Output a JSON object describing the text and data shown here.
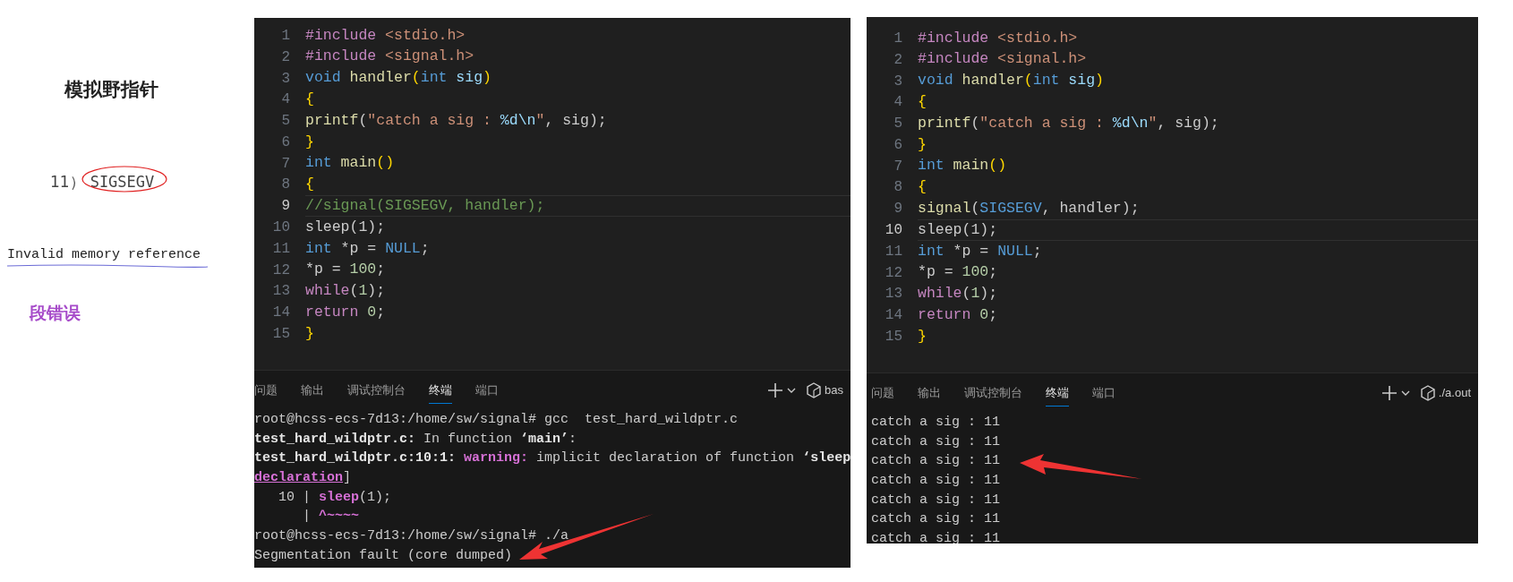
{
  "notes": {
    "title": "模拟野指针",
    "signal_number": "11）",
    "signal_name": "SIGSEGV",
    "description": "Invalid memory reference",
    "meaning": "段错误"
  },
  "editors": [
    {
      "lines": [
        {
          "number": "1",
          "current": false,
          "tokens": [
            {
              "kind": "directive",
              "text": "#include"
            },
            {
              "kind": "string",
              "text": " <stdio.h>"
            }
          ]
        },
        {
          "number": "2",
          "current": false,
          "tokens": [
            {
              "kind": "directive",
              "text": "#include"
            },
            {
              "kind": "string",
              "text": " <signal.h>"
            }
          ]
        },
        {
          "number": "3",
          "current": false,
          "tokens": [
            {
              "kind": "keyword",
              "text": "void"
            },
            {
              "kind": "func",
              "text": " handler"
            },
            {
              "kind": "bracket",
              "text": "("
            },
            {
              "kind": "keyword",
              "text": "int"
            },
            {
              "kind": "param",
              "text": " sig"
            },
            {
              "kind": "bracket",
              "text": ")"
            }
          ]
        },
        {
          "number": "4",
          "current": false,
          "tokens": [
            {
              "kind": "bracket",
              "text": "{"
            }
          ]
        },
        {
          "number": "5",
          "current": false,
          "tokens": [
            {
              "kind": "func",
              "text": "printf"
            },
            {
              "kind": "plain",
              "text": "("
            },
            {
              "kind": "string",
              "text": "\"catch a sig : "
            },
            {
              "kind": "format",
              "text": "%d\\n"
            },
            {
              "kind": "string",
              "text": "\""
            },
            {
              "kind": "plain",
              "text": ", sig);"
            }
          ]
        },
        {
          "number": "6",
          "current": false,
          "tokens": [
            {
              "kind": "bracket",
              "text": "}"
            }
          ]
        },
        {
          "number": "7",
          "current": false,
          "tokens": [
            {
              "kind": "keyword",
              "text": "int"
            },
            {
              "kind": "func",
              "text": " main"
            },
            {
              "kind": "bracket",
              "text": "()"
            }
          ]
        },
        {
          "number": "8",
          "current": false,
          "tokens": [
            {
              "kind": "bracket",
              "text": "{"
            }
          ]
        },
        {
          "number": "9",
          "current": true,
          "tokens": [
            {
              "kind": "comment",
              "text": "//signal(SIGSEGV, handler);"
            }
          ]
        },
        {
          "number": "10",
          "current": false,
          "tokens": [
            {
              "kind": "plain",
              "text": "sleep(1);"
            }
          ]
        },
        {
          "number": "11",
          "current": false,
          "tokens": [
            {
              "kind": "keyword",
              "text": "int"
            },
            {
              "kind": "plain",
              "text": " *p = "
            },
            {
              "kind": "keyword",
              "text": "NULL"
            },
            {
              "kind": "plain",
              "text": ";"
            }
          ]
        },
        {
          "number": "12",
          "current": false,
          "tokens": [
            {
              "kind": "plain",
              "text": "*p = "
            },
            {
              "kind": "number",
              "text": "100"
            },
            {
              "kind": "plain",
              "text": ";"
            }
          ]
        },
        {
          "number": "13",
          "current": false,
          "tokens": [
            {
              "kind": "directive",
              "text": "while"
            },
            {
              "kind": "plain",
              "text": "("
            },
            {
              "kind": "number",
              "text": "1"
            },
            {
              "kind": "plain",
              "text": ");"
            }
          ]
        },
        {
          "number": "14",
          "current": false,
          "tokens": [
            {
              "kind": "directive",
              "text": "return"
            },
            {
              "kind": "number",
              "text": " 0"
            },
            {
              "kind": "plain",
              "text": ";"
            }
          ]
        },
        {
          "number": "15",
          "current": false,
          "tokens": [
            {
              "kind": "bracket",
              "text": "}"
            }
          ]
        }
      ],
      "panel": {
        "tabs": [
          {
            "label": "问题",
            "selected": false
          },
          {
            "label": "输出",
            "selected": false
          },
          {
            "label": "调试控制台",
            "selected": false
          },
          {
            "label": "终端",
            "selected": true
          },
          {
            "label": "端口",
            "selected": false
          }
        ],
        "shell_label": "bas",
        "lines": [
          [
            {
              "kind": "plain",
              "text": "root@hcss-ecs-7d13:/home/sw/signal# gcc  test_hard_wildptr.c"
            }
          ],
          [
            {
              "kind": "bold",
              "text": "test_hard_wildptr.c:"
            },
            {
              "kind": "plain",
              "text": " In function "
            },
            {
              "kind": "bold",
              "text": "‘main’"
            },
            {
              "kind": "plain",
              "text": ":"
            }
          ],
          [
            {
              "kind": "bold",
              "text": "test_hard_wildptr.c:10:1:"
            },
            {
              "kind": "warning",
              "text": " warning:"
            },
            {
              "kind": "plain",
              "text": " implicit declaration of function "
            },
            {
              "kind": "bold",
              "text": "‘sleep"
            }
          ],
          [
            {
              "kind": "link",
              "text": "declaration"
            },
            {
              "kind": "plain",
              "text": "]"
            }
          ],
          [
            {
              "kind": "plain",
              "text": "   10 | "
            },
            {
              "kind": "warning",
              "text": "sleep"
            },
            {
              "kind": "plain",
              "text": "(1);"
            }
          ],
          [
            {
              "kind": "plain",
              "text": "      | "
            },
            {
              "kind": "warning",
              "text": "^~~~~"
            }
          ],
          [
            {
              "kind": "plain",
              "text": "root@hcss-ecs-7d13:/home/sw/signal# ./a"
            }
          ],
          [
            {
              "kind": "plain",
              "text": "Segmentation fault (core dumped)"
            }
          ]
        ]
      }
    },
    {
      "lines": [
        {
          "number": "1",
          "current": false,
          "tokens": [
            {
              "kind": "directive",
              "text": "#include"
            },
            {
              "kind": "string",
              "text": " <stdio.h>"
            }
          ]
        },
        {
          "number": "2",
          "current": false,
          "tokens": [
            {
              "kind": "directive",
              "text": "#include"
            },
            {
              "kind": "string",
              "text": " <signal.h>"
            }
          ]
        },
        {
          "number": "3",
          "current": false,
          "tokens": [
            {
              "kind": "keyword",
              "text": "void"
            },
            {
              "kind": "func",
              "text": " handler"
            },
            {
              "kind": "bracket",
              "text": "("
            },
            {
              "kind": "keyword",
              "text": "int"
            },
            {
              "kind": "param",
              "text": " sig"
            },
            {
              "kind": "bracket",
              "text": ")"
            }
          ]
        },
        {
          "number": "4",
          "current": false,
          "tokens": [
            {
              "kind": "bracket",
              "text": "{"
            }
          ]
        },
        {
          "number": "5",
          "current": false,
          "tokens": [
            {
              "kind": "func",
              "text": "printf"
            },
            {
              "kind": "plain",
              "text": "("
            },
            {
              "kind": "string",
              "text": "\"catch a sig : "
            },
            {
              "kind": "format",
              "text": "%d\\n"
            },
            {
              "kind": "string",
              "text": "\""
            },
            {
              "kind": "plain",
              "text": ", sig);"
            }
          ]
        },
        {
          "number": "6",
          "current": false,
          "tokens": [
            {
              "kind": "bracket",
              "text": "}"
            }
          ]
        },
        {
          "number": "7",
          "current": false,
          "tokens": [
            {
              "kind": "keyword",
              "text": "int"
            },
            {
              "kind": "func",
              "text": " main"
            },
            {
              "kind": "bracket",
              "text": "()"
            }
          ]
        },
        {
          "number": "8",
          "current": false,
          "tokens": [
            {
              "kind": "bracket",
              "text": "{"
            }
          ]
        },
        {
          "number": "9",
          "current": false,
          "tokens": [
            {
              "kind": "func",
              "text": "signal"
            },
            {
              "kind": "plain",
              "text": "("
            },
            {
              "kind": "keyword",
              "text": "SIGSEGV"
            },
            {
              "kind": "plain",
              "text": ", handler);"
            }
          ]
        },
        {
          "number": "10",
          "current": true,
          "tokens": [
            {
              "kind": "plain",
              "text": "sleep(1);"
            }
          ]
        },
        {
          "number": "11",
          "current": false,
          "tokens": [
            {
              "kind": "keyword",
              "text": "int"
            },
            {
              "kind": "plain",
              "text": " *p = "
            },
            {
              "kind": "keyword",
              "text": "NULL"
            },
            {
              "kind": "plain",
              "text": ";"
            }
          ]
        },
        {
          "number": "12",
          "current": false,
          "tokens": [
            {
              "kind": "plain",
              "text": "*p = "
            },
            {
              "kind": "number",
              "text": "100"
            },
            {
              "kind": "plain",
              "text": ";"
            }
          ]
        },
        {
          "number": "13",
          "current": false,
          "tokens": [
            {
              "kind": "directive",
              "text": "while"
            },
            {
              "kind": "plain",
              "text": "("
            },
            {
              "kind": "number",
              "text": "1"
            },
            {
              "kind": "plain",
              "text": ");"
            }
          ]
        },
        {
          "number": "14",
          "current": false,
          "tokens": [
            {
              "kind": "directive",
              "text": "return"
            },
            {
              "kind": "number",
              "text": " 0"
            },
            {
              "kind": "plain",
              "text": ";"
            }
          ]
        },
        {
          "number": "15",
          "current": false,
          "tokens": [
            {
              "kind": "bracket",
              "text": "}"
            }
          ]
        }
      ],
      "panel": {
        "tabs": [
          {
            "label": "问题",
            "selected": false
          },
          {
            "label": "输出",
            "selected": false
          },
          {
            "label": "调试控制台",
            "selected": false
          },
          {
            "label": "终端",
            "selected": true
          },
          {
            "label": "端口",
            "selected": false
          }
        ],
        "shell_label": "./a.out",
        "lines": [
          [
            {
              "kind": "plain",
              "text": "catch a sig : 11"
            }
          ],
          [
            {
              "kind": "plain",
              "text": "catch a sig : 11"
            }
          ],
          [
            {
              "kind": "plain",
              "text": "catch a sig : 11"
            }
          ],
          [
            {
              "kind": "plain",
              "text": "catch a sig : 11"
            }
          ],
          [
            {
              "kind": "plain",
              "text": "catch a sig : 11"
            }
          ],
          [
            {
              "kind": "plain",
              "text": "catch a sig : 11"
            }
          ],
          [
            {
              "kind": "plain",
              "text": "catch a sig : 11"
            }
          ]
        ]
      }
    }
  ]
}
